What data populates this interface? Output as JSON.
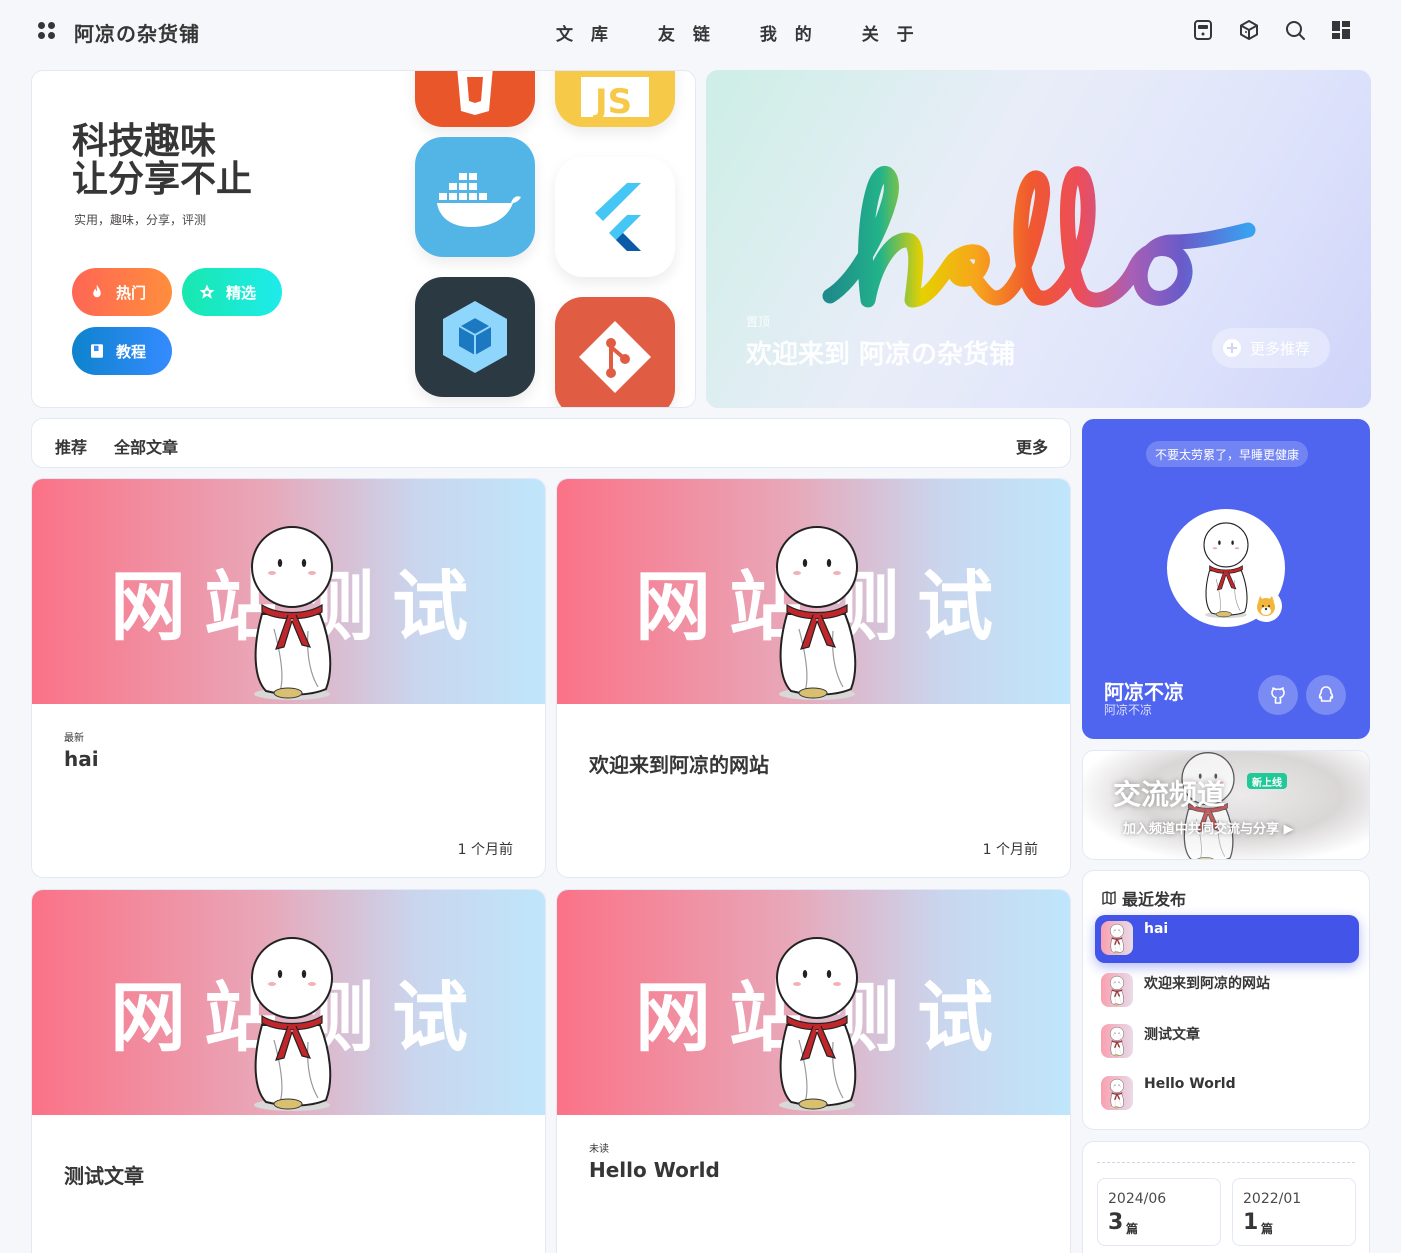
{
  "header": {
    "site_title": "阿凉の杂货铺",
    "nav": [
      "文 库",
      "友 链",
      "我 的",
      "关 于"
    ]
  },
  "hero": {
    "title": "科技趣味\n让分享不止",
    "subtitle": "实用，趣味，分享，评测",
    "buttons": {
      "hot": "热门",
      "selected": "精选",
      "tutorial": "教程"
    },
    "banner_tag": "置顶",
    "banner_caption": "欢迎来到 阿凉の杂货铺",
    "more_recommend": "更多推荐"
  },
  "category_bar": {
    "recommend": "推荐",
    "all": "全部文章",
    "more": "更多"
  },
  "posts": [
    {
      "cover_text": "网站测试",
      "tag": "最新",
      "title": "hai",
      "time": "1 个月前"
    },
    {
      "cover_text": "网站测试",
      "tag": "",
      "title": "欢迎来到阿凉的网站",
      "time": "1 个月前"
    },
    {
      "cover_text": "网站测试",
      "tag": "",
      "title": "测试文章",
      "time": ""
    },
    {
      "cover_text": "网站测试",
      "tag": "未读",
      "title": "Hello World",
      "time": ""
    }
  ],
  "author_card": {
    "tip": "不要太劳累了，早睡更健康",
    "name": "阿凉不凉",
    "description": "阿凉不凉"
  },
  "channel": {
    "title": "交流频道",
    "badge": "新上线",
    "subtitle": "加入频道中共同交流与分享 ▶"
  },
  "recent": {
    "heading": "最近发布",
    "items": [
      "hai",
      "欢迎来到阿凉的网站",
      "测试文章",
      "Hello World"
    ]
  },
  "archive": [
    {
      "date": "2024/06",
      "count": "3",
      "unit": "篇"
    },
    {
      "date": "2022/01",
      "count": "1",
      "unit": "篇"
    }
  ],
  "colors": {
    "accent": "#4f65f0",
    "active": "#4355e8",
    "hot": "#ff6655",
    "selected": "#18e7ae",
    "tutorial": "#358bff"
  }
}
